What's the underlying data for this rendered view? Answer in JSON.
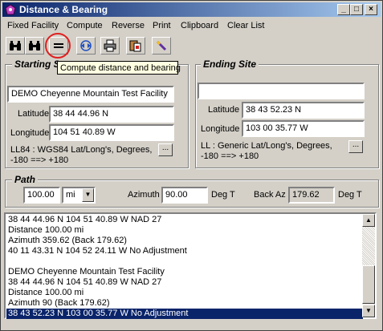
{
  "window": {
    "title": "Distance & Bearing"
  },
  "menu": [
    "Fixed Facility",
    "Compute",
    "Reverse",
    "Print",
    "Clipboard",
    "Clear List"
  ],
  "tooltip": "Compute distance and bearing",
  "starting_site": {
    "title": "Starting S",
    "name": "DEMO Cheyenne Mountain Test Facility",
    "latitude_label": "Latitude",
    "latitude": "38 44 44.96 N",
    "longitude_label": "Longitude",
    "longitude": "104 51 40.89 W",
    "datum_line1": "LL84 : WGS84 Lat/Long's, Degrees,",
    "datum_line2": "-180 ==> +180",
    "datum_button": "..."
  },
  "ending_site": {
    "title": "Ending Site",
    "name": "",
    "latitude_label": "Latitude",
    "latitude": "38 43 52.23 N",
    "longitude_label": "Longitude",
    "longitude": "103 00 35.77 W",
    "datum_line1": "LL : Generic Lat/Long's, Degrees,",
    "datum_line2": "-180 ==> +180",
    "datum_button": "..."
  },
  "path": {
    "title": "Path",
    "distance": "100.00",
    "unit": "mi",
    "azimuth_label": "Azimuth",
    "azimuth": "90.00",
    "azimuth_unit": "Deg T",
    "back_az_label": "Back Az",
    "back_az": "179.62",
    "back_az_unit": "Deg T"
  },
  "results": [
    "38 44 44.96 N 104 51 40.89 W NAD 27",
    "Distance 100.00 mi",
    "Azimuth  359.62 (Back 179.62)",
    "40 11 43.31 N 104 52 24.11 W No Adjustment",
    "",
    "DEMO Cheyenne Mountain Test Facility",
    "38 44 44.96 N 104 51 40.89 W NAD 27",
    "Distance 100.00 mi",
    "Azimuth  90 (Back 179.62)",
    "38 43 52.23 N 103 00 35.77 W No Adjustment"
  ],
  "selected_result_index": 9
}
